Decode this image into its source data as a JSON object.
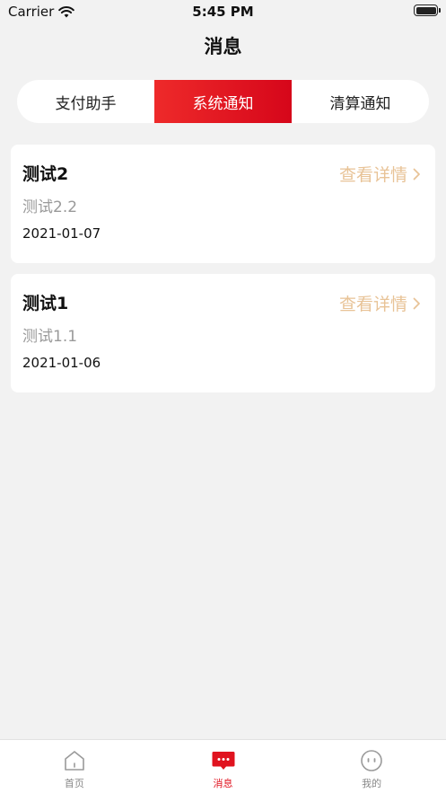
{
  "status_bar": {
    "carrier": "Carrier",
    "time": "5:45 PM"
  },
  "header": {
    "title": "消息"
  },
  "tabs": [
    {
      "label": "支付助手",
      "active": false
    },
    {
      "label": "系统通知",
      "active": true
    },
    {
      "label": "清算通知",
      "active": false
    }
  ],
  "messages": [
    {
      "title": "测试2",
      "subtitle": "测试2.2",
      "date": "2021-01-07",
      "link": "查看详情"
    },
    {
      "title": "测试1",
      "subtitle": "测试1.1",
      "date": "2021-01-06",
      "link": "查看详情"
    }
  ],
  "tabbar": [
    {
      "label": "首页",
      "icon": "home-icon",
      "active": false
    },
    {
      "label": "消息",
      "icon": "message-icon",
      "active": true
    },
    {
      "label": "我的",
      "icon": "profile-icon",
      "active": false
    }
  ],
  "colors": {
    "accent": "#e0131f",
    "link": "#e8c397",
    "background": "#f2f2f2"
  }
}
